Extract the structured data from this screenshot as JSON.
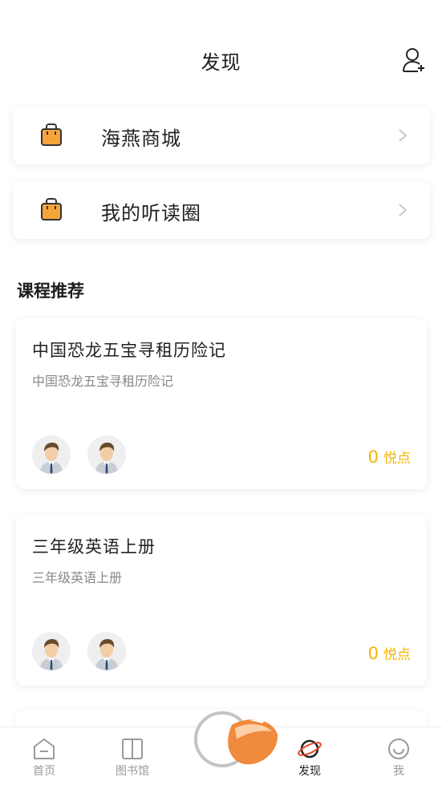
{
  "header": {
    "title": "发现",
    "add_user_icon": "add-user-icon"
  },
  "menu": [
    {
      "label": "海燕商城",
      "icon": "shopping-bag-icon"
    },
    {
      "label": "我的听读圈",
      "icon": "shopping-bag-icon"
    }
  ],
  "section": {
    "title": "课程推荐"
  },
  "courses": [
    {
      "title": "中国恐龙五宝寻租历险记",
      "subtitle": "中国恐龙五宝寻租历险记",
      "points": "0",
      "points_unit": "悦点"
    },
    {
      "title": "三年级英语上册",
      "subtitle": "三年级英语上册",
      "points": "0",
      "points_unit": "悦点"
    }
  ],
  "tabs": [
    {
      "label": "首页",
      "icon": "home-icon"
    },
    {
      "label": "图书馆",
      "icon": "book-icon"
    },
    {
      "label": "发现",
      "icon": "planet-icon",
      "active": true
    },
    {
      "label": "我",
      "icon": "smile-icon"
    }
  ],
  "colors": {
    "accent": "#f5b400",
    "icon_orange": "#f6a53a",
    "tab_inactive": "#9a9a9a"
  }
}
